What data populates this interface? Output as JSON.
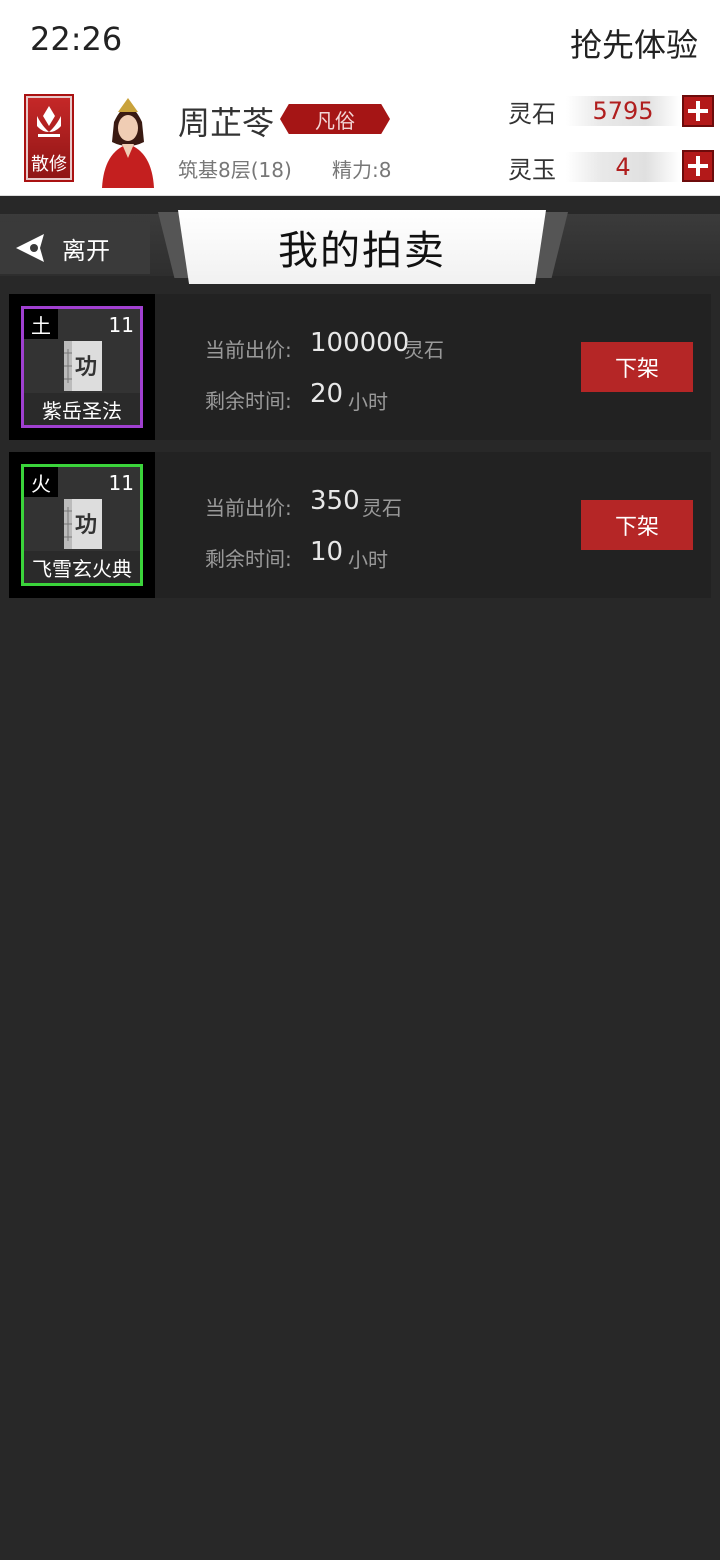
{
  "status_bar": {
    "time": "22:26",
    "right_text": "抢先体验"
  },
  "player": {
    "sect": "散修",
    "name": "周芷苓",
    "rank": "凡俗",
    "level": "筑基8层(18)",
    "energy": "精力:8"
  },
  "currencies": [
    {
      "label": "灵石",
      "value": "5795"
    },
    {
      "label": "灵玉",
      "value": "4"
    }
  ],
  "nav": {
    "back_label": "离开",
    "title": "我的拍卖"
  },
  "listing_labels": {
    "current_bid": "当前出价:",
    "remaining_time": "剩余时间:",
    "time_unit": "小时",
    "delist": "下架"
  },
  "listings": [
    {
      "element": "土",
      "level": "11",
      "icon_char": "功",
      "name": "紫岳圣法",
      "bid": "100000",
      "bid_unit": "灵石",
      "hours": "20",
      "frame_color": "#a040d0"
    },
    {
      "element": "火",
      "level": "11",
      "icon_char": "功",
      "name": "飞雪玄火典",
      "bid": "350",
      "bid_unit": "灵石",
      "hours": "10",
      "frame_color": "#3bd43b"
    }
  ],
  "colors": {
    "accent_red": "#b52626",
    "background": "#282828"
  }
}
